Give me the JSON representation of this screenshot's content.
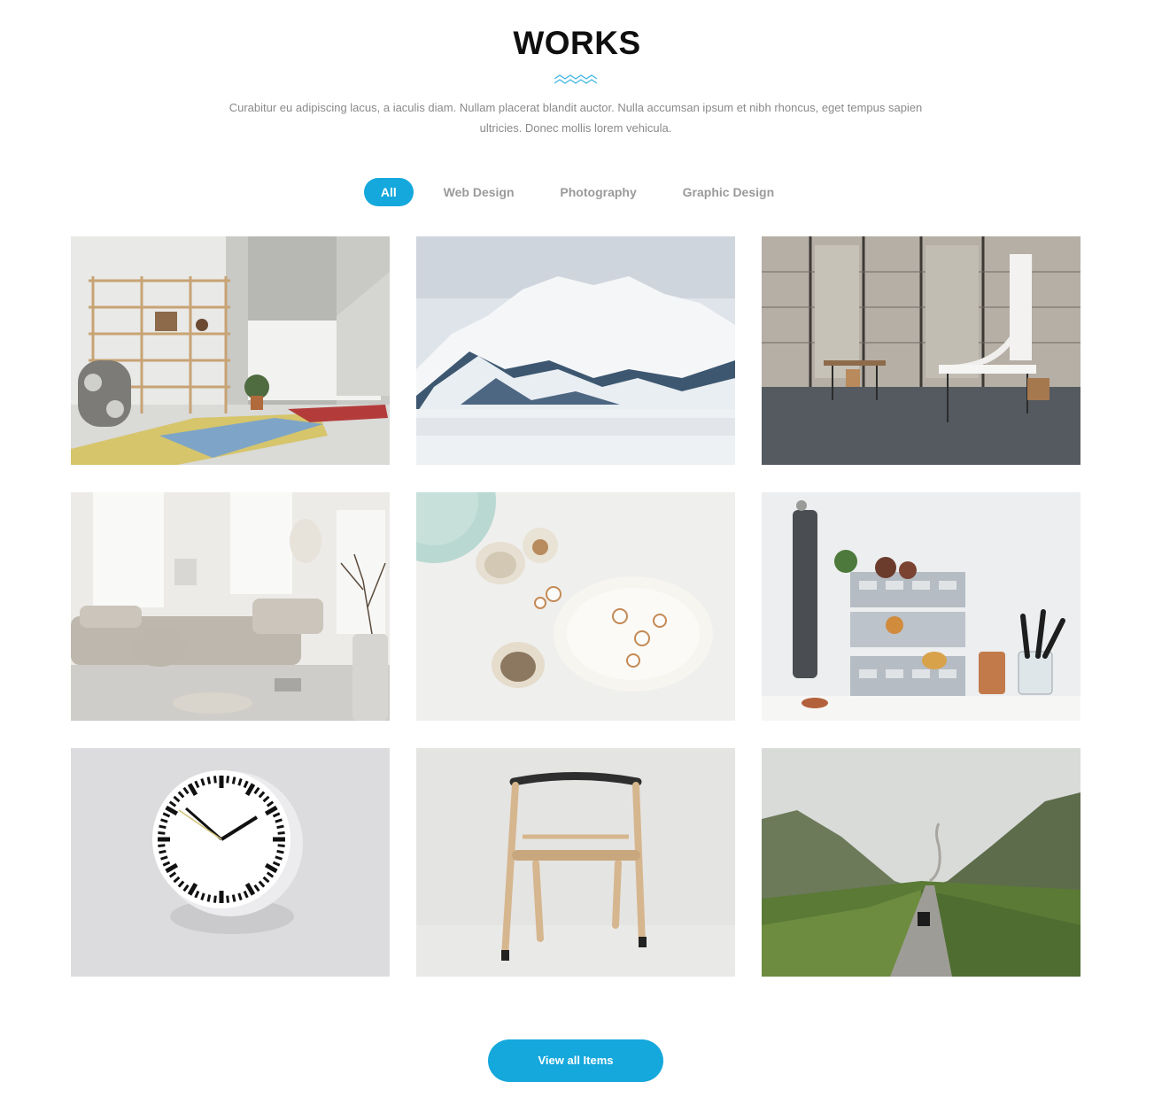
{
  "section": {
    "title": "WORKS",
    "intro": "Curabitur eu adipiscing lacus, a iaculis diam. Nullam placerat blandit auctor. Nulla accumsan ipsum et nibh rhoncus, eget tempus sapien ultricies. Donec mollis lorem vehicula."
  },
  "filters": [
    {
      "label": "All",
      "active": true
    },
    {
      "label": "Web Design",
      "active": false
    },
    {
      "label": "Photography",
      "active": false
    },
    {
      "label": "Graphic Design",
      "active": false
    }
  ],
  "portfolio": [
    {
      "subject": "interior-shelf-living-room"
    },
    {
      "subject": "snowy-mountains"
    },
    {
      "subject": "industrial-dining-space"
    },
    {
      "subject": "white-living-room-sofa"
    },
    {
      "subject": "ceramic-bowls-popcorn"
    },
    {
      "subject": "kitchen-crates-vegetables"
    },
    {
      "subject": "wall-clock"
    },
    {
      "subject": "wooden-chair"
    },
    {
      "subject": "highland-road"
    }
  ],
  "cta": {
    "label": "View all Items"
  },
  "colors": {
    "accent": "#15a8dc",
    "title": "#0f0f0f",
    "muted_text": "#8a8a8a"
  }
}
